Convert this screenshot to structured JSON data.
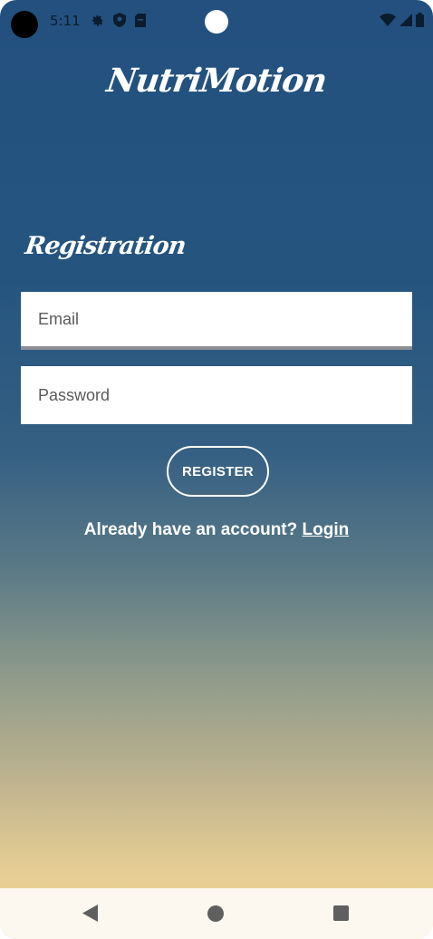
{
  "status_bar": {
    "time": "5:11",
    "left_icons": [
      "gear-icon",
      "shield-icon",
      "sim-card-icon"
    ],
    "right_icons": [
      "wifi-icon",
      "signal-icon",
      "battery-icon"
    ]
  },
  "app": {
    "title": "NutriMotion"
  },
  "form": {
    "section_title": "Registration",
    "email_placeholder": "Email",
    "password_placeholder": "Password",
    "register_label": "REGISTER",
    "login_prompt": "Already have an account?",
    "login_link": "Login"
  },
  "nav_bar": {
    "buttons": [
      "back-icon",
      "home-icon",
      "recents-icon"
    ]
  },
  "colors": {
    "gradient_top": "#23507f",
    "gradient_bottom": "#f2d796",
    "nav_bar_bg": "#fdf8ef"
  }
}
